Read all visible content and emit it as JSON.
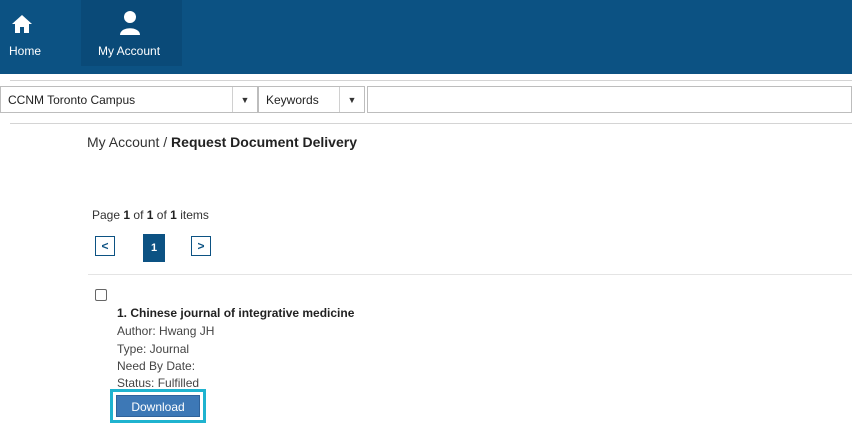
{
  "nav": {
    "home_label": "Home",
    "account_label": "My Account",
    "home_icon": "home-icon",
    "account_icon": "user-icon"
  },
  "search": {
    "location_value": "CCNM Toronto Campus",
    "field_value": "Keywords",
    "query_value": ""
  },
  "breadcrumb": {
    "parent": "My Account",
    "separator": " / ",
    "current": "Request Document Delivery"
  },
  "pagination": {
    "page_word": "Page",
    "current_page": "1",
    "of_word": "of",
    "total_pages": "1",
    "total_items": "1",
    "items_word": "items",
    "prev_symbol": "<",
    "next_symbol": ">"
  },
  "results": [
    {
      "title": "1. Chinese journal of integrative medicine",
      "author": "Author: Hwang JH",
      "type": "Type: Journal",
      "need_by": "Need By Date:",
      "status": "Status: Fulfilled",
      "download_label": "Download"
    }
  ],
  "colors": {
    "header": "#0c5283",
    "button": "#3d78b6",
    "highlight": "#1fb3cf"
  }
}
